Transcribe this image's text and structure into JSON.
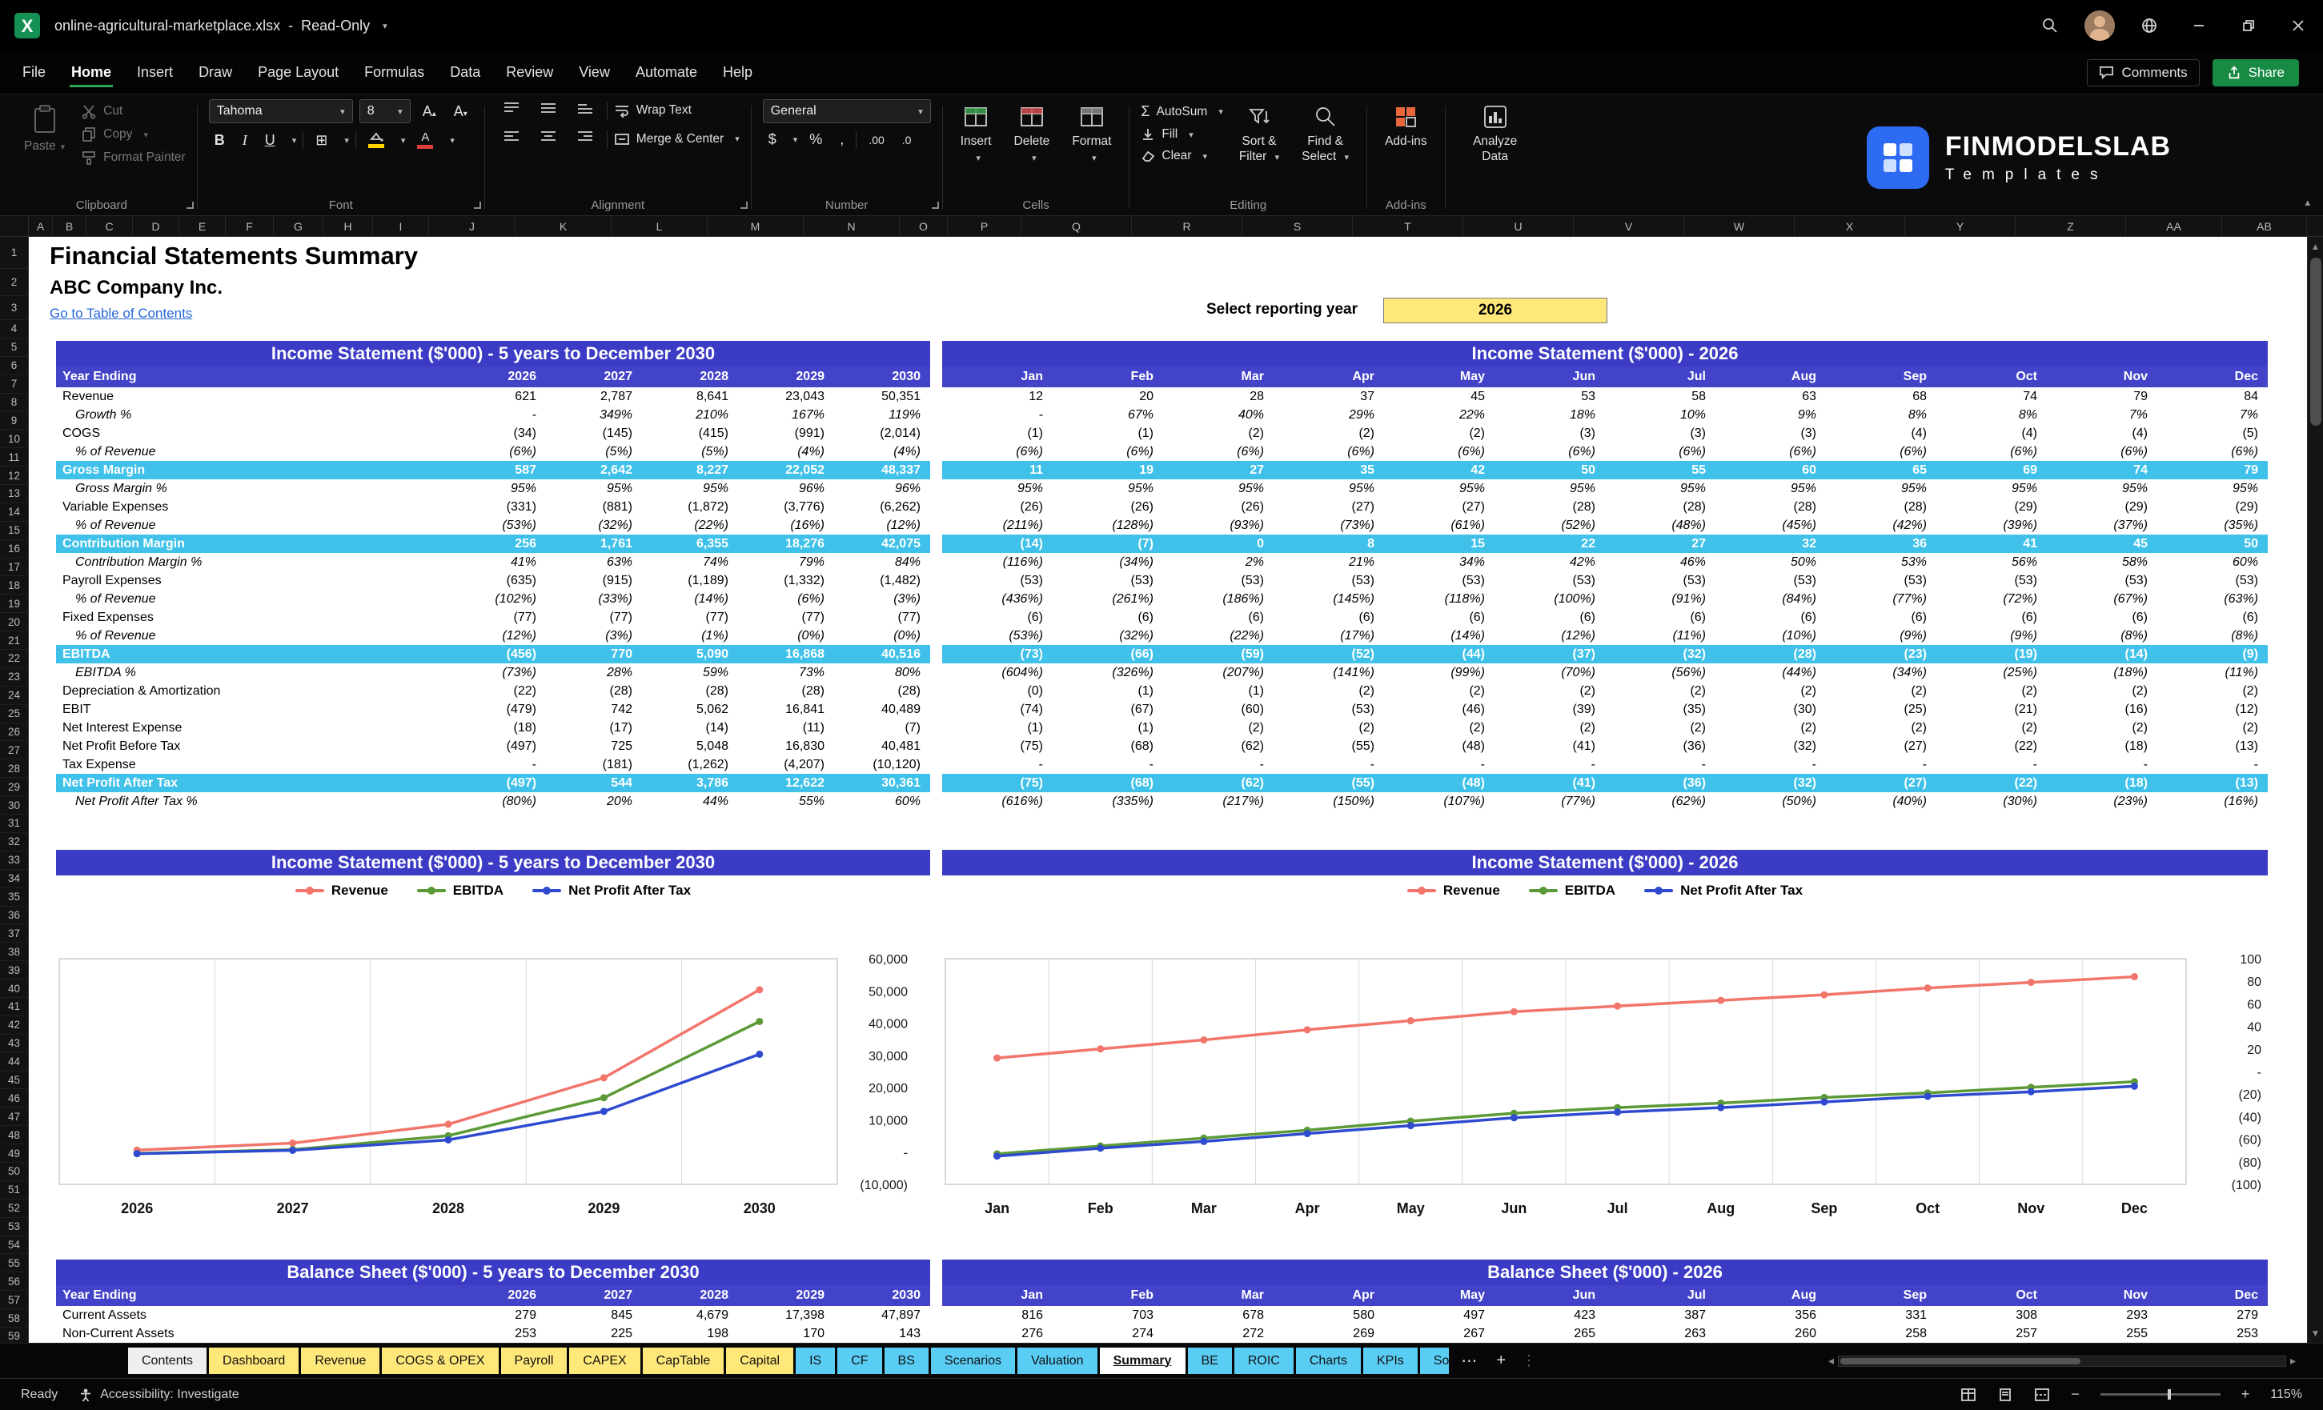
{
  "window": {
    "title": "online-agricultural-marketplace.xlsx",
    "separator": "-",
    "mode": "Read-Only"
  },
  "menubar": {
    "items": [
      "File",
      "Home",
      "Insert",
      "Draw",
      "Page Layout",
      "Formulas",
      "Data",
      "Review",
      "View",
      "Automate",
      "Help"
    ],
    "active_item": "Home",
    "comments_label": "Comments",
    "share_label": "Share"
  },
  "ribbon": {
    "clipboard": {
      "group_label": "Clipboard",
      "paste": "Paste",
      "cut": "Cut",
      "copy": "Copy",
      "format_painter": "Format Painter"
    },
    "font": {
      "group_label": "Font",
      "font_name": "Tahoma",
      "font_size": "8"
    },
    "alignment": {
      "group_label": "Alignment",
      "wrap_text": "Wrap Text",
      "merge_center": "Merge & Center"
    },
    "number": {
      "group_label": "Number",
      "format": "General"
    },
    "cells": {
      "group_label": "Cells",
      "insert": "Insert",
      "delete": "Delete",
      "format": "Format"
    },
    "editing": {
      "group_label": "Editing",
      "autosum": "AutoSum",
      "fill": "Fill",
      "clear": "Clear",
      "sort_filter_1": "Sort &",
      "sort_filter_2": "Filter",
      "find_select_1": "Find &",
      "find_select_2": "Select"
    },
    "addins": {
      "group_label": "Add-ins",
      "button": "Add-ins"
    },
    "analyze": {
      "label": "Analyze Data"
    }
  },
  "brand": {
    "name": "FINMODELSLAB",
    "subtitle": "Templates"
  },
  "sheet": {
    "columns": [
      "A",
      "B",
      "C",
      "D",
      "E",
      "F",
      "G",
      "H",
      "I",
      "J",
      "K",
      "L",
      "M",
      "N",
      "O",
      "P",
      "Q",
      "R",
      "S",
      "T",
      "U",
      "V",
      "W",
      "X",
      "Y",
      "Z",
      "AA",
      "AB"
    ],
    "row_count": 60,
    "page_title": "Financial Statements Summary",
    "company": "ABC Company Inc.",
    "toc_link": "Go to Table of Contents",
    "reporting_year_label": "Select reporting year",
    "reporting_year": "2026"
  },
  "tables": {
    "row_labels": [
      "Revenue",
      "Growth %",
      "COGS",
      "% of Revenue",
      "Gross Margin",
      "Gross Margin %",
      "Variable Expenses",
      "% of Revenue",
      "Contribution Margin",
      "Contribution Margin %",
      "Payroll Expenses",
      "% of Revenue",
      "Fixed Expenses",
      "% of Revenue",
      "EBITDA",
      "EBITDA %",
      "Depreciation & Amortization",
      "EBIT",
      "Net Interest Expense",
      "Net Profit Before Tax",
      "Tax Expense",
      "Net Profit After Tax",
      "Net Profit After Tax %"
    ],
    "row_styles": [
      "normal",
      "pct",
      "normal",
      "pct",
      "total",
      "pct",
      "normal",
      "pct",
      "total",
      "pct",
      "normal",
      "pct",
      "normal",
      "pct",
      "total",
      "pct",
      "normal",
      "normal",
      "normal",
      "normal",
      "normal",
      "total",
      "pct"
    ],
    "is_annual": {
      "title": "Income Statement ($'000) - 5 years to December 2030",
      "header_label": "Year Ending",
      "columns": [
        "2026",
        "2027",
        "2028",
        "2029",
        "2030"
      ],
      "rows": [
        [
          "621",
          "2,787",
          "8,641",
          "23,043",
          "50,351"
        ],
        [
          "-",
          "349%",
          "210%",
          "167%",
          "119%"
        ],
        [
          "(34)",
          "(145)",
          "(415)",
          "(991)",
          "(2,014)"
        ],
        [
          "(6%)",
          "(5%)",
          "(5%)",
          "(4%)",
          "(4%)"
        ],
        [
          "587",
          "2,642",
          "8,227",
          "22,052",
          "48,337"
        ],
        [
          "95%",
          "95%",
          "95%",
          "96%",
          "96%"
        ],
        [
          "(331)",
          "(881)",
          "(1,872)",
          "(3,776)",
          "(6,262)"
        ],
        [
          "(53%)",
          "(32%)",
          "(22%)",
          "(16%)",
          "(12%)"
        ],
        [
          "256",
          "1,761",
          "6,355",
          "18,276",
          "42,075"
        ],
        [
          "41%",
          "63%",
          "74%",
          "79%",
          "84%"
        ],
        [
          "(635)",
          "(915)",
          "(1,189)",
          "(1,332)",
          "(1,482)"
        ],
        [
          "(102%)",
          "(33%)",
          "(14%)",
          "(6%)",
          "(3%)"
        ],
        [
          "(77)",
          "(77)",
          "(77)",
          "(77)",
          "(77)"
        ],
        [
          "(12%)",
          "(3%)",
          "(1%)",
          "(0%)",
          "(0%)"
        ],
        [
          "(456)",
          "770",
          "5,090",
          "16,868",
          "40,516"
        ],
        [
          "(73%)",
          "28%",
          "59%",
          "73%",
          "80%"
        ],
        [
          "(22)",
          "(28)",
          "(28)",
          "(28)",
          "(28)"
        ],
        [
          "(479)",
          "742",
          "5,062",
          "16,841",
          "40,489"
        ],
        [
          "(18)",
          "(17)",
          "(14)",
          "(11)",
          "(7)"
        ],
        [
          "(497)",
          "725",
          "5,048",
          "16,830",
          "40,481"
        ],
        [
          "-",
          "(181)",
          "(1,262)",
          "(4,207)",
          "(10,120)"
        ],
        [
          "(497)",
          "544",
          "3,786",
          "12,622",
          "30,361"
        ],
        [
          "(80%)",
          "20%",
          "44%",
          "55%",
          "60%"
        ]
      ]
    },
    "is_monthly": {
      "title": "Income Statement ($'000) - 2026",
      "columns": [
        "Jan",
        "Feb",
        "Mar",
        "Apr",
        "May",
        "Jun",
        "Jul",
        "Aug",
        "Sep",
        "Oct",
        "Nov",
        "Dec"
      ],
      "rows": [
        [
          "12",
          "20",
          "28",
          "37",
          "45",
          "53",
          "58",
          "63",
          "68",
          "74",
          "79",
          "84"
        ],
        [
          "-",
          "67%",
          "40%",
          "29%",
          "22%",
          "18%",
          "10%",
          "9%",
          "8%",
          "8%",
          "7%",
          "7%"
        ],
        [
          "(1)",
          "(1)",
          "(2)",
          "(2)",
          "(2)",
          "(3)",
          "(3)",
          "(3)",
          "(4)",
          "(4)",
          "(4)",
          "(5)"
        ],
        [
          "(6%)",
          "(6%)",
          "(6%)",
          "(6%)",
          "(6%)",
          "(6%)",
          "(6%)",
          "(6%)",
          "(6%)",
          "(6%)",
          "(6%)",
          "(6%)"
        ],
        [
          "11",
          "19",
          "27",
          "35",
          "42",
          "50",
          "55",
          "60",
          "65",
          "69",
          "74",
          "79"
        ],
        [
          "95%",
          "95%",
          "95%",
          "95%",
          "95%",
          "95%",
          "95%",
          "95%",
          "95%",
          "95%",
          "95%",
          "95%"
        ],
        [
          "(26)",
          "(26)",
          "(26)",
          "(27)",
          "(27)",
          "(28)",
          "(28)",
          "(28)",
          "(28)",
          "(29)",
          "(29)",
          "(29)"
        ],
        [
          "(211%)",
          "(128%)",
          "(93%)",
          "(73%)",
          "(61%)",
          "(52%)",
          "(48%)",
          "(45%)",
          "(42%)",
          "(39%)",
          "(37%)",
          "(35%)"
        ],
        [
          "(14)",
          "(7)",
          "0",
          "8",
          "15",
          "22",
          "27",
          "32",
          "36",
          "41",
          "45",
          "50"
        ],
        [
          "(116%)",
          "(34%)",
          "2%",
          "21%",
          "34%",
          "42%",
          "46%",
          "50%",
          "53%",
          "56%",
          "58%",
          "60%"
        ],
        [
          "(53)",
          "(53)",
          "(53)",
          "(53)",
          "(53)",
          "(53)",
          "(53)",
          "(53)",
          "(53)",
          "(53)",
          "(53)",
          "(53)"
        ],
        [
          "(436%)",
          "(261%)",
          "(186%)",
          "(145%)",
          "(118%)",
          "(100%)",
          "(91%)",
          "(84%)",
          "(77%)",
          "(72%)",
          "(67%)",
          "(63%)"
        ],
        [
          "(6)",
          "(6)",
          "(6)",
          "(6)",
          "(6)",
          "(6)",
          "(6)",
          "(6)",
          "(6)",
          "(6)",
          "(6)",
          "(6)"
        ],
        [
          "(53%)",
          "(32%)",
          "(22%)",
          "(17%)",
          "(14%)",
          "(12%)",
          "(11%)",
          "(10%)",
          "(9%)",
          "(9%)",
          "(8%)",
          "(8%)"
        ],
        [
          "(73)",
          "(66)",
          "(59)",
          "(52)",
          "(44)",
          "(37)",
          "(32)",
          "(28)",
          "(23)",
          "(19)",
          "(14)",
          "(9)"
        ],
        [
          "(604%)",
          "(326%)",
          "(207%)",
          "(141%)",
          "(99%)",
          "(70%)",
          "(56%)",
          "(44%)",
          "(34%)",
          "(25%)",
          "(18%)",
          "(11%)"
        ],
        [
          "(0)",
          "(1)",
          "(1)",
          "(2)",
          "(2)",
          "(2)",
          "(2)",
          "(2)",
          "(2)",
          "(2)",
          "(2)",
          "(2)"
        ],
        [
          "(74)",
          "(67)",
          "(60)",
          "(53)",
          "(46)",
          "(39)",
          "(35)",
          "(30)",
          "(25)",
          "(21)",
          "(16)",
          "(12)"
        ],
        [
          "(1)",
          "(1)",
          "(2)",
          "(2)",
          "(2)",
          "(2)",
          "(2)",
          "(2)",
          "(2)",
          "(2)",
          "(2)",
          "(2)"
        ],
        [
          "(75)",
          "(68)",
          "(62)",
          "(55)",
          "(48)",
          "(41)",
          "(36)",
          "(32)",
          "(27)",
          "(22)",
          "(18)",
          "(13)"
        ],
        [
          "-",
          "-",
          "-",
          "-",
          "-",
          "-",
          "-",
          "-",
          "-",
          "-",
          "-",
          "-"
        ],
        [
          "(75)",
          "(68)",
          "(62)",
          "(55)",
          "(48)",
          "(41)",
          "(36)",
          "(32)",
          "(27)",
          "(22)",
          "(18)",
          "(13)"
        ],
        [
          "(616%)",
          "(335%)",
          "(217%)",
          "(150%)",
          "(107%)",
          "(77%)",
          "(62%)",
          "(50%)",
          "(40%)",
          "(30%)",
          "(23%)",
          "(16%)"
        ]
      ]
    },
    "bs_annual": {
      "title": "Balance Sheet ($'000) - 5 years to December 2030",
      "header_label": "Year Ending",
      "columns": [
        "2026",
        "2027",
        "2028",
        "2029",
        "2030"
      ],
      "row_labels": [
        "Current Assets",
        "Non-Current Assets"
      ],
      "rows": [
        [
          "279",
          "845",
          "4,679",
          "17,398",
          "47,897"
        ],
        [
          "253",
          "225",
          "198",
          "170",
          "143"
        ]
      ]
    },
    "bs_monthly": {
      "title": "Balance Sheet ($'000) - 2026",
      "columns": [
        "Jan",
        "Feb",
        "Mar",
        "Apr",
        "May",
        "Jun",
        "Jul",
        "Aug",
        "Sep",
        "Oct",
        "Nov",
        "Dec"
      ],
      "rows": [
        [
          "816",
          "703",
          "678",
          "580",
          "497",
          "423",
          "387",
          "356",
          "331",
          "308",
          "293",
          "279"
        ],
        [
          "276",
          "274",
          "272",
          "269",
          "267",
          "265",
          "263",
          "260",
          "258",
          "257",
          "255",
          "253"
        ]
      ]
    }
  },
  "chart_data": [
    {
      "type": "line",
      "title": "Income Statement ($'000) - 5 years to December 2030",
      "categories": [
        "2026",
        "2027",
        "2028",
        "2029",
        "2030"
      ],
      "series": [
        {
          "name": "Revenue",
          "color": "#F2756B",
          "values": [
            621,
            2787,
            8641,
            23043,
            50351
          ]
        },
        {
          "name": "EBITDA",
          "color": "#5C9A38",
          "values": [
            -456,
            770,
            5090,
            16868,
            40516
          ]
        },
        {
          "name": "Net Profit After Tax",
          "color": "#2E4BD0",
          "values": [
            -497,
            544,
            3786,
            12622,
            30361
          ]
        }
      ],
      "ylim": [
        -10000,
        60000
      ],
      "ytick": 10000,
      "grid": "vertical",
      "legend": "top",
      "y_axis_side": "right"
    },
    {
      "type": "line",
      "title": "Income Statement ($'000) - 2026",
      "categories": [
        "Jan",
        "Feb",
        "Mar",
        "Apr",
        "May",
        "Jun",
        "Jul",
        "Aug",
        "Sep",
        "Oct",
        "Nov",
        "Dec"
      ],
      "series": [
        {
          "name": "Revenue",
          "color": "#F2756B",
          "values": [
            12,
            20,
            28,
            37,
            45,
            53,
            58,
            63,
            68,
            74,
            79,
            84
          ]
        },
        {
          "name": "EBITDA",
          "color": "#5C9A38",
          "values": [
            -73,
            -66,
            -59,
            -52,
            -44,
            -37,
            -32,
            -28,
            -23,
            -19,
            -14,
            -9
          ]
        },
        {
          "name": "Net Profit After Tax",
          "color": "#2E4BD0",
          "values": [
            -75,
            -68,
            -62,
            -55,
            -48,
            -41,
            -36,
            -32,
            -27,
            -22,
            -18,
            -13
          ]
        }
      ],
      "ylim": [
        -100,
        100
      ],
      "ytick": 20,
      "grid": "vertical",
      "legend": "top",
      "y_axis_side": "right"
    }
  ],
  "tabs": {
    "items": [
      {
        "label": "Contents",
        "color": "light"
      },
      {
        "label": "Dashboard",
        "color": "yellow"
      },
      {
        "label": "Revenue",
        "color": "yellow"
      },
      {
        "label": "COGS & OPEX",
        "color": "yellow"
      },
      {
        "label": "Payroll",
        "color": "yellow"
      },
      {
        "label": "CAPEX",
        "color": "yellow"
      },
      {
        "label": "CapTable",
        "color": "yellow"
      },
      {
        "label": "Capital",
        "color": "yellow"
      },
      {
        "label": "IS",
        "color": "blue"
      },
      {
        "label": "CF",
        "color": "blue"
      },
      {
        "label": "BS",
        "color": "blue"
      },
      {
        "label": "Scenarios",
        "color": "blue"
      },
      {
        "label": "Valuation",
        "color": "blue"
      },
      {
        "label": "Summary",
        "color": "active"
      },
      {
        "label": "BE",
        "color": "blue"
      },
      {
        "label": "ROIC",
        "color": "blue"
      },
      {
        "label": "Charts",
        "color": "blue"
      },
      {
        "label": "KPIs",
        "color": "blue"
      },
      {
        "label": "So",
        "color": "blue",
        "truncated": true
      }
    ],
    "more_icon": "⋯",
    "add_icon": "+"
  },
  "statusbar": {
    "ready": "Ready",
    "accessibility": "Accessibility: Investigate",
    "zoom": "115%"
  }
}
